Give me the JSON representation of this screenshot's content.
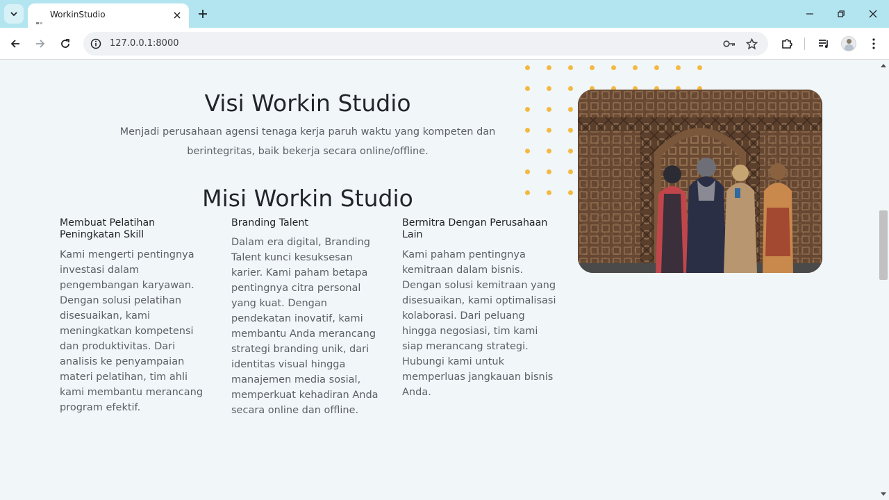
{
  "browser": {
    "tab_title": "WorkinStudio",
    "url": "127.0.0.1:8000"
  },
  "page": {
    "visi": {
      "title": "Visi Workin Studio",
      "text": "Menjadi perusahaan agensi tenaga kerja paruh waktu yang kompeten dan berintegritas, baik bekerja secara online/offline."
    },
    "misi": {
      "title": "Misi Workin Studio",
      "items": [
        {
          "title": "Membuat Pelatihan Peningkatan Skill",
          "text": "Kami mengerti pentingnya investasi dalam pengembangan karyawan. Dengan solusi pelatihan disesuaikan, kami meningkatkan kompetensi dan produktivitas. Dari analisis ke penyampaian materi pelatihan, tim ahli kami membantu merancang program efektif."
        },
        {
          "title": "Branding Talent",
          "text": "Dalam era digital, Branding Talent kunci kesuksesan karier. Kami paham betapa pentingnya citra personal yang kuat. Dengan pendekatan inovatif, kami membantu Anda merancang strategi branding unik, dari identitas visual hingga manajemen media sosial, memperkuat kehadiran Anda secara online dan offline."
        },
        {
          "title": "Bermitra Dengan Perusahaan Lain",
          "text": "Kami paham pentingnya kemitraan dalam bisnis. Dengan solusi kemitraan yang disesuaikan, kami optimalisasi kolaborasi. Dari peluang hingga negosiasi, tim kami siap merancang strategi. Hubungi kami untuk memperluas jangkauan bisnis Anda."
        }
      ]
    }
  },
  "colors": {
    "titlebar": "#b3e5f0",
    "page_bg": "#f1f6f9",
    "dot_accent": "#f4b942",
    "heading": "#22262a",
    "body_text": "#5b6066"
  }
}
